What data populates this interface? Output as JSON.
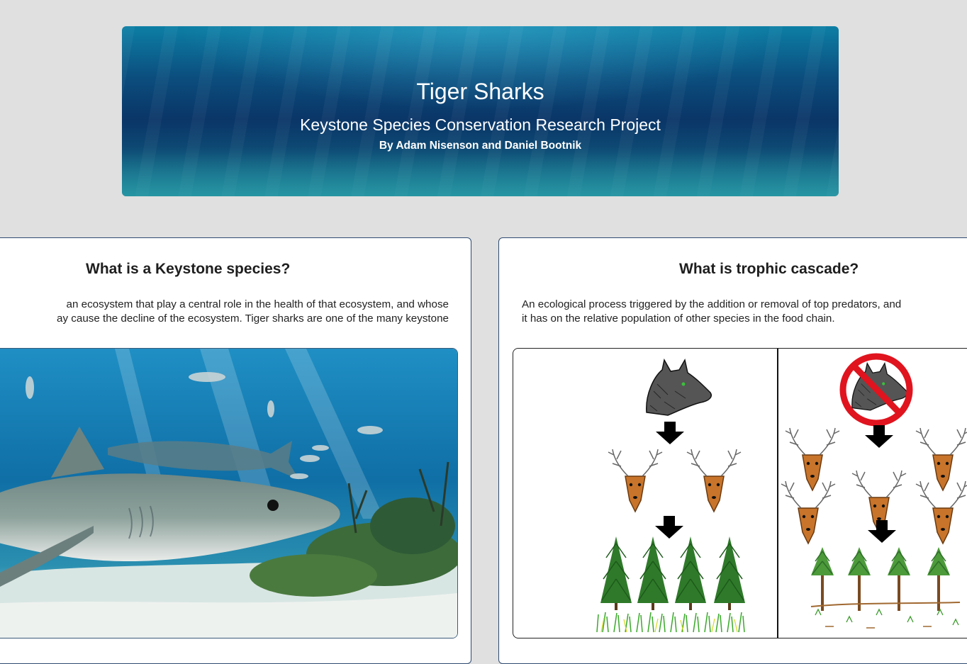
{
  "header": {
    "title": "Tiger Sharks",
    "subtitle": "Keystone Species Conservation Research Project",
    "authors": "By Adam Nisenson and Daniel Bootnik"
  },
  "keystone_card": {
    "heading": "What is a Keystone species?",
    "text_lines": [
      "an ecosystem that play a central role in the health of that ecosystem, and whose",
      "ay cause the decline of the ecosystem. Tiger sharks are one of the many keystone"
    ],
    "image_icon": "tiger-shark-photo"
  },
  "trophic_card": {
    "heading": "What is trophic cascade?",
    "text_lines": [
      "An ecological process triggered by the addition or removal of top predators, and",
      "it has on the relative population of other species in the food chain."
    ],
    "image_icon": "trophic-cascade-diagram"
  },
  "colors": {
    "page_background": "#e0e0e0",
    "card_border": "#2e4a70",
    "banner_deep": "#0a3567",
    "prohibited_red": "#e0141e"
  }
}
